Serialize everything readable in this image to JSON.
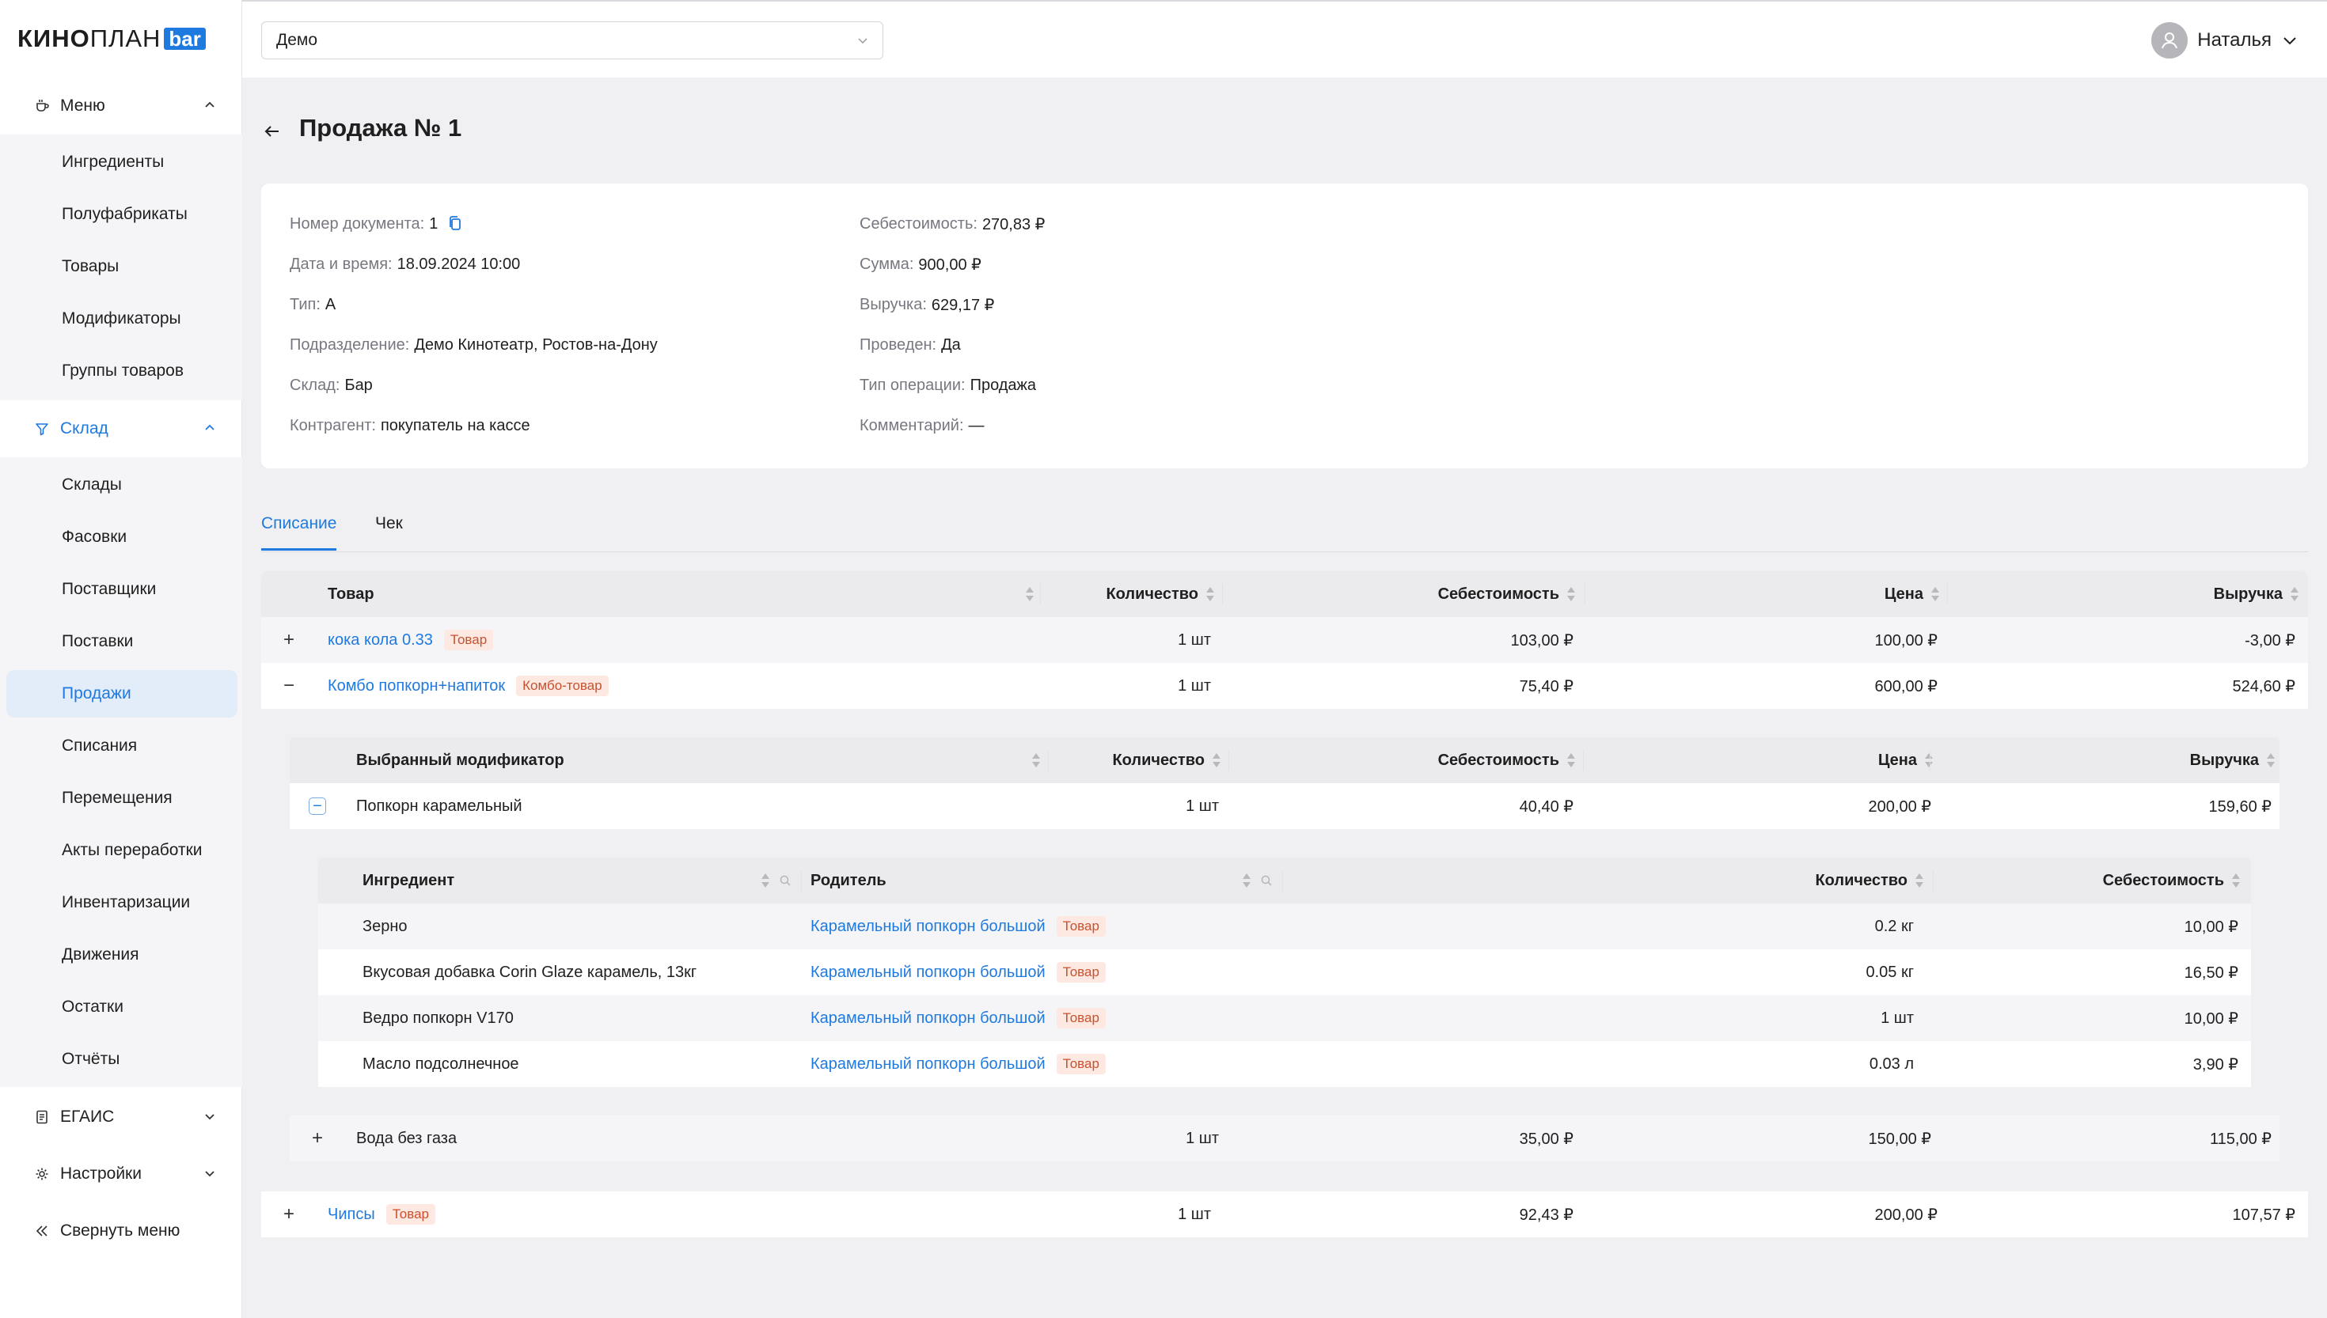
{
  "app": {
    "logo_main_bold": "КИНО",
    "logo_main_thin": "ПЛАН",
    "logo_badge": "bar",
    "accent_color": "#1f7ae0"
  },
  "sidebar": {
    "groups": {
      "menu": {
        "label": "Меню",
        "icon": "cup-icon"
      },
      "sklad": {
        "label": "Склад",
        "icon": "funnel-icon"
      },
      "egais": {
        "label": "ЕГАИС",
        "icon": "document-icon"
      },
      "settings": {
        "label": "Настройки",
        "icon": "gear-icon"
      },
      "collapse": {
        "label": "Свернуть меню",
        "icon": "double-chevron-left-icon"
      }
    },
    "menu_items": [
      "Ингредиенты",
      "Полуфабрикаты",
      "Товары",
      "Модификаторы",
      "Группы товаров"
    ],
    "sklad_items": [
      "Склады",
      "Фасовки",
      "Поставщики",
      "Поставки",
      "Продажи",
      "Списания",
      "Перемещения",
      "Акты переработки",
      "Инвентаризации",
      "Движения",
      "Остатки",
      "Отчёты"
    ],
    "selected_item": "Продажи"
  },
  "topbar": {
    "org_select_value": "Демо",
    "user_name": "Наталья"
  },
  "page": {
    "title": "Продажа № 1"
  },
  "info": {
    "left": [
      {
        "label": "Номер документа:",
        "value": "1"
      },
      {
        "label": "Дата и время:",
        "value": "18.09.2024 10:00"
      },
      {
        "label": "Тип:",
        "value": "А"
      },
      {
        "label": "Подразделение:",
        "value": "Демо Кинотеатр, Ростов-на-Дону"
      },
      {
        "label": "Склад:",
        "value": "Бар"
      },
      {
        "label": "Контрагент:",
        "value": "покупатель на кассе"
      }
    ],
    "right": [
      {
        "label": "Себестоимость:",
        "value": "270,83 ₽"
      },
      {
        "label": "Сумма:",
        "value": "900,00 ₽"
      },
      {
        "label": "Выручка:",
        "value": "629,17 ₽"
      },
      {
        "label": "Проведен:",
        "value": "Да"
      },
      {
        "label": "Тип операции:",
        "value": "Продажа"
      },
      {
        "label": "Комментарий:",
        "value": "—"
      }
    ]
  },
  "tabs": [
    {
      "label": "Списание",
      "active": true
    },
    {
      "label": "Чек",
      "active": false
    }
  ],
  "main_table": {
    "headers": [
      "Товар",
      "Количество",
      "Себестоимость",
      "Цена",
      "Выручка"
    ],
    "rows": [
      {
        "expander": "+",
        "name": "кока кола 0.33",
        "badge": "Товар",
        "qty": "1 шт",
        "cost": "103,00 ₽",
        "price": "100,00 ₽",
        "revenue": "-3,00 ₽"
      },
      {
        "expander": "−",
        "name": "Комбо попкорн+напиток",
        "badge": "Комбо-товар",
        "qty": "1 шт",
        "cost": "75,40 ₽",
        "price": "600,00 ₽",
        "revenue": "524,60 ₽"
      },
      {
        "expander": "+",
        "name": "Чипсы",
        "badge": "Товар",
        "qty": "1 шт",
        "cost": "92,43 ₽",
        "price": "200,00 ₽",
        "revenue": "107,57 ₽"
      }
    ]
  },
  "modifier_table": {
    "headers": [
      "Выбранный модификатор",
      "Количество",
      "Себестоимость",
      "Цена",
      "Выручка"
    ],
    "rows": [
      {
        "expander": "−",
        "name": "Попкорн карамельный",
        "qty": "1 шт",
        "cost": "40,40 ₽",
        "price": "200,00 ₽",
        "revenue": "159,60 ₽"
      },
      {
        "expander": "+",
        "name": "Вода без газа",
        "qty": "1 шт",
        "cost": "35,00 ₽",
        "price": "150,00 ₽",
        "revenue": "115,00 ₽"
      }
    ]
  },
  "ingredient_table": {
    "headers": [
      "Ингредиент",
      "Родитель",
      "Количество",
      "Себестоимость"
    ],
    "rows": [
      {
        "name": "Зерно",
        "parent": "Карамельный попкорн большой",
        "badge": "Товар",
        "qty": "0.2 кг",
        "cost": "10,00 ₽"
      },
      {
        "name": "Вкусовая добавка Corin Glaze карамель, 13кг",
        "parent": "Карамельный попкорн большой",
        "badge": "Товар",
        "qty": "0.05 кг",
        "cost": "16,50 ₽"
      },
      {
        "name": "Ведро попкорн V170",
        "parent": "Карамельный попкорн большой",
        "badge": "Товар",
        "qty": "1 шт",
        "cost": "10,00 ₽"
      },
      {
        "name": "Масло подсолнечное",
        "parent": "Карамельный попкорн большой",
        "badge": "Товар",
        "qty": "0.03 л",
        "cost": "3,90 ₽"
      }
    ]
  }
}
